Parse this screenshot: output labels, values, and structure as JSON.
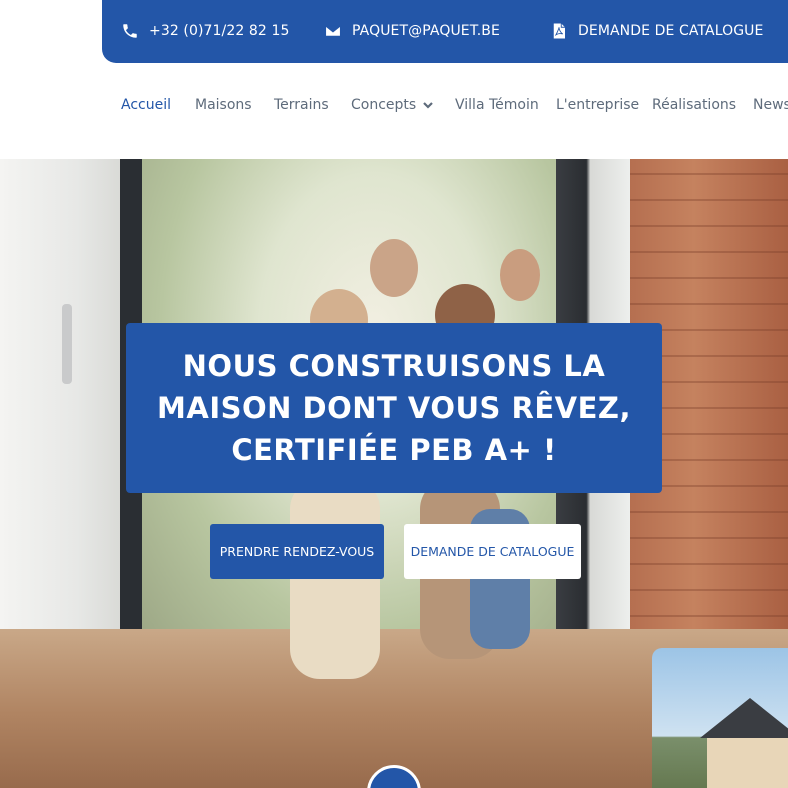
{
  "topbar": {
    "phone": "+32 (0)71/22 82 15",
    "email": "PAQUET@PAQUET.BE",
    "catalog": "DEMANDE DE CATALOGUE",
    "phone_icon": "phone-icon",
    "email_icon": "envelope-icon",
    "catalog_icon": "pdf-file-icon"
  },
  "nav": {
    "items": [
      {
        "label": "Accueil",
        "active": true
      },
      {
        "label": "Maisons"
      },
      {
        "label": "Terrains"
      },
      {
        "label": "Concepts",
        "dropdown": true
      },
      {
        "label": "Villa Témoin"
      },
      {
        "label": "L'entreprise"
      },
      {
        "label": "Réalisations"
      },
      {
        "label": "News"
      }
    ]
  },
  "hero": {
    "headline_line1": "NOUS CONSTRUISONS LA",
    "headline_line2": "MAISON DONT VOUS RÊVEZ,",
    "headline_line3": "CERTIFIÉE PEB A+ !",
    "primary_button": "PRENDRE RENDEZ-VOUS",
    "secondary_button": "DEMANDE DE CATALOGUE"
  },
  "colors": {
    "brand_blue": "#2356a8",
    "nav_text": "#5e6b7b",
    "white": "#ffffff"
  }
}
